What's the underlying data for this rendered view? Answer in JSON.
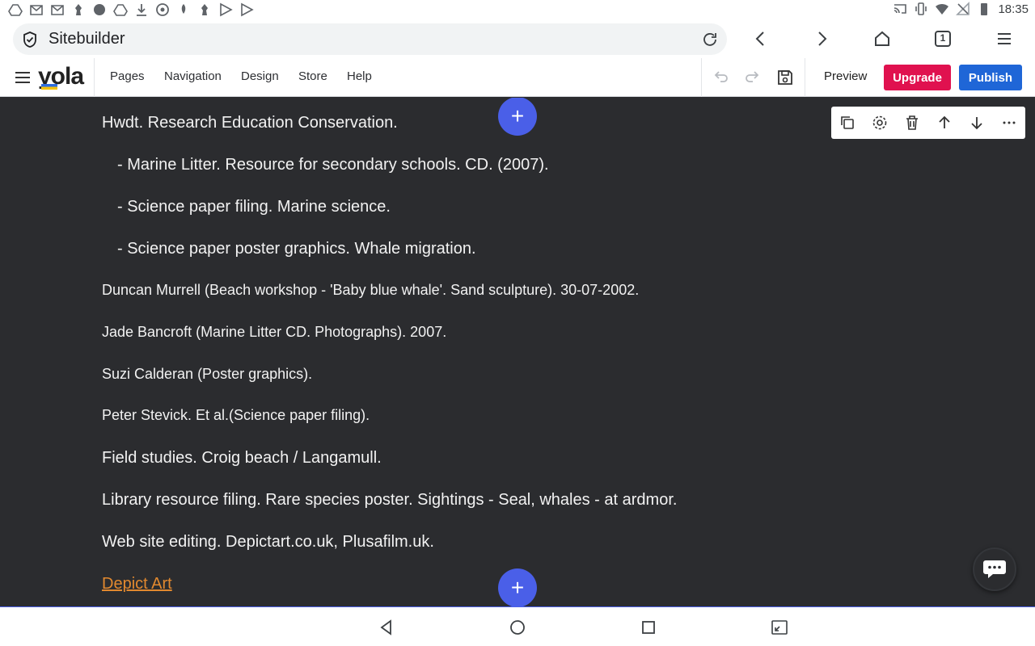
{
  "status_bar": {
    "time": "18:35"
  },
  "browser": {
    "url_text": "Sitebuilder",
    "tab_count": "1"
  },
  "app": {
    "logo_text": "yola",
    "menu": [
      "Pages",
      "Navigation",
      "Design",
      "Store",
      "Help"
    ],
    "preview_label": "Preview",
    "upgrade_label": "Upgrade",
    "publish_label": "Publish"
  },
  "content": {
    "lines": [
      "Hwdt. Research Education Conservation.",
      "- Marine Litter. Resource for secondary schools. CD. (2007).",
      "- Science paper filing. Marine science.",
      "- Science paper poster graphics. Whale migration.",
      "Duncan Murrell (Beach workshop - 'Baby blue whale'. Sand sculpture). 30-07-2002.",
      "Jade Bancroft (Marine Litter CD. Photographs). 2007.",
      "Suzi Calderan (Poster graphics).",
      "Peter Stevick. Et al.(Science paper filing).",
      "Field studies. Croig beach / Langamull.",
      "Library resource filing. Rare species poster.  Sightings - Seal, whales - at ardmor.",
      "Web site editing. Depictart.co.uk,  Plusafilm.uk."
    ],
    "link_text": "Depict Art"
  },
  "colors": {
    "upgrade": "#e0114f",
    "publish": "#1f66d7",
    "add_button": "#4a5fe8",
    "link": "#e2892f",
    "canvas_bg": "#2b2c2f"
  }
}
